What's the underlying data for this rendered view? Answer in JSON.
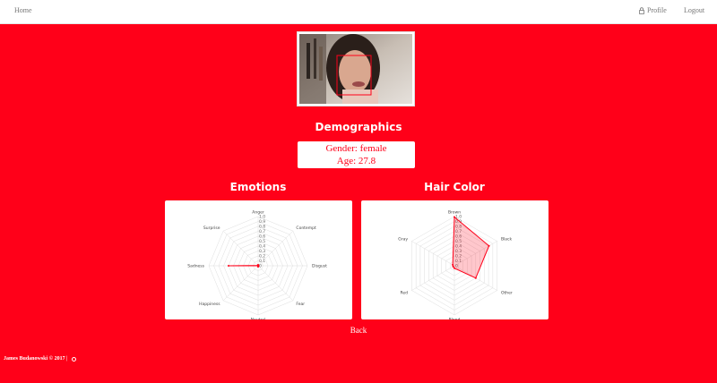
{
  "nav": {
    "home_label": "Home",
    "profile_label": "Profile",
    "profile_icon": "lock-icon",
    "logout_label": "Logout"
  },
  "demographics": {
    "title": "Demographics",
    "gender": "Gender: female",
    "age": "Age: 27.8"
  },
  "emotions": {
    "title": "Emotions"
  },
  "hair": {
    "title": "Hair Color"
  },
  "back_label": "Back",
  "footer": {
    "text": "James Budanowski © 2017 |",
    "icon": "github-icon"
  },
  "colors": {
    "accent": "#ff0019",
    "card": "#ffffff",
    "plot": "#ff0019"
  },
  "chart_data": [
    {
      "type": "radar",
      "title": "Emotions",
      "categories": [
        "Anger",
        "Contempt",
        "Disgust",
        "Fear",
        "Neutral",
        "Happiness",
        "Sadness",
        "Surprise"
      ],
      "tick_labels": [
        "1.0",
        "0.9",
        "0.8",
        "0.7",
        "0.6",
        "0.5",
        "0.4",
        "0.3",
        "0.2",
        "0.1",
        "0"
      ],
      "range": [
        0,
        1
      ],
      "values": [
        0.02,
        0.0,
        0.01,
        0.0,
        0.02,
        0.0,
        0.6,
        0.01
      ]
    },
    {
      "type": "radar",
      "title": "Hair Color",
      "categories": [
        "Brown",
        "Black",
        "Other",
        "Blond",
        "Red",
        "Gray"
      ],
      "tick_labels": [
        "1.0",
        "0.9",
        "0.8",
        "0.7",
        "0.6",
        "0.5",
        "0.4",
        "0.3",
        "0.2",
        "0.1",
        "0"
      ],
      "range": [
        0,
        1
      ],
      "values": [
        0.99,
        0.81,
        0.5,
        0.05,
        0.03,
        0.04
      ]
    }
  ]
}
